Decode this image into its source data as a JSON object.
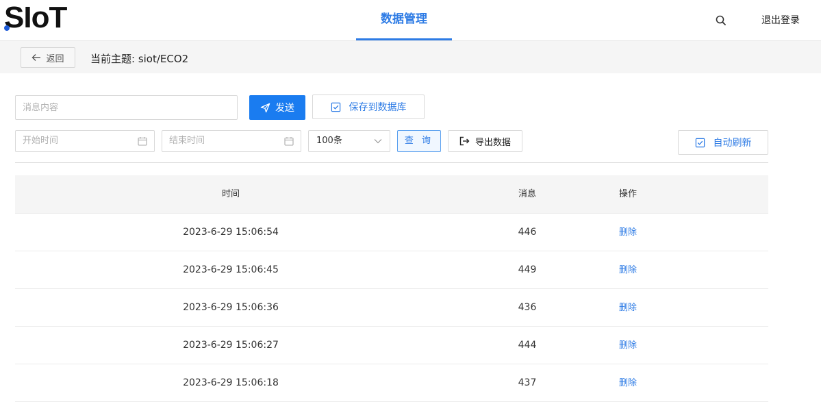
{
  "header": {
    "logo": "SIoT",
    "nav_tab": "数据管理",
    "logout": "退出登录"
  },
  "topic_bar": {
    "back_label": "返回",
    "topic_label": "当前主题: siot/ECO2"
  },
  "controls": {
    "message_placeholder": "消息内容",
    "send_label": "发送",
    "save_db_label": "保存到数据库",
    "start_time_placeholder": "开始时间",
    "end_time_placeholder": "结束时间",
    "limit_selected": "100条",
    "query_label": "查 询",
    "export_label": "导出数据",
    "auto_refresh_label": "自动刷新"
  },
  "table": {
    "headers": {
      "time": "时间",
      "message": "消息",
      "action": "操作"
    },
    "rows": [
      {
        "time": "2023-6-29 15:06:54",
        "message": "446",
        "action": "删除"
      },
      {
        "time": "2023-6-29 15:06:45",
        "message": "449",
        "action": "删除"
      },
      {
        "time": "2023-6-29 15:06:36",
        "message": "436",
        "action": "删除"
      },
      {
        "time": "2023-6-29 15:06:27",
        "message": "444",
        "action": "删除"
      },
      {
        "time": "2023-6-29 15:06:18",
        "message": "437",
        "action": "删除"
      }
    ]
  },
  "icons": {
    "search": "search-icon",
    "back": "arrow-left-icon",
    "send": "paper-plane-icon",
    "save": "checkbox-icon",
    "calendar": "calendar-icon",
    "dropdown": "chevron-down-icon",
    "export": "sign-out-icon"
  },
  "colors": {
    "accent": "#2d7be5",
    "send_button": "#1a7cf0",
    "logo_dot": "#1e5bd8"
  }
}
